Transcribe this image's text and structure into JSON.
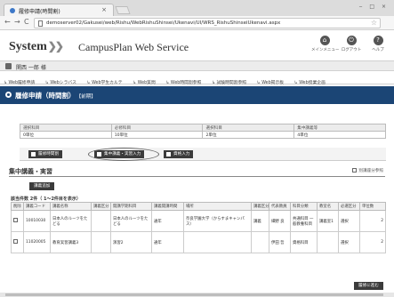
{
  "browser": {
    "tab_title": "履修申請(時間割)",
    "tab_close": "×",
    "url": "demoserver02/Gakusei/web/Rishu/WebRishuShinsei/Ukenavi/UI/WRS_RishuShinseiUkenavi.aspx",
    "nav": {
      "back": "←",
      "forward": "→",
      "reload": "C"
    },
    "window_controls": "‒ □ ×"
  },
  "app": {
    "logo_text": "System",
    "logo_chevrons": "❯❯",
    "name": "CampusPlan Web Service",
    "header_icons": [
      {
        "icon": "house-icon",
        "glyph": "⌂",
        "label": "メインメニュー"
      },
      {
        "icon": "logout-icon",
        "glyph": "⏻",
        "label": "ログアウト"
      },
      {
        "icon": "help-icon",
        "glyph": "?",
        "label": "ヘルプ"
      }
    ]
  },
  "user": {
    "name": "関西 一郎 様"
  },
  "menu": [
    "Web履修申請",
    "Webシラバス",
    "Web学生カルテ",
    "Web質問",
    "Web時間割参照",
    "試験時間割参照",
    "Web掲示板",
    "Web授業企画"
  ],
  "page_title": {
    "main": "履修申請（時間割）",
    "sub": "【前期】"
  },
  "summary": {
    "headers": [
      "選択科目",
      "必修科目",
      "選択科目",
      "集中講義等"
    ],
    "values": [
      "0単位",
      "10単位",
      "2単位",
      "4単位"
    ]
  },
  "tab_buttons": [
    {
      "label": "履修時間割"
    },
    {
      "label": "集中講義・実習入力"
    },
    {
      "label": "資格入力"
    }
  ],
  "section": {
    "title": "集中講義・実習",
    "link": "別講座分参照",
    "add_button": "講義追加",
    "count_label": "該当件数 2件（ 1～2件目を表示）"
  },
  "grid": {
    "headers": [
      "削除",
      "講義コード",
      "講義名称",
      "講義区分",
      "開講学期科目",
      "講義開講時間",
      "場所",
      "講義区分",
      "代表教員",
      "科目分類",
      "教室名",
      "必選区分",
      "単位数"
    ],
    "rows": [
      [
        "",
        "10010030",
        "日本人のルーツをたどる",
        "",
        "日本人のルーツをたどる",
        "通年",
        "奈良学園大学（からすまキャンパス）",
        "講義",
        "細野 良",
        "共通科目 一般教養科目",
        "講義室1",
        "選択",
        "2"
      ],
      [
        "",
        "11020005",
        "教育実習講義3",
        "",
        "演習2",
        "通年",
        "",
        "",
        "伊田 哲",
        "資格科目",
        "",
        "選択",
        "2"
      ]
    ]
  },
  "confirm_button": "履修に進む"
}
